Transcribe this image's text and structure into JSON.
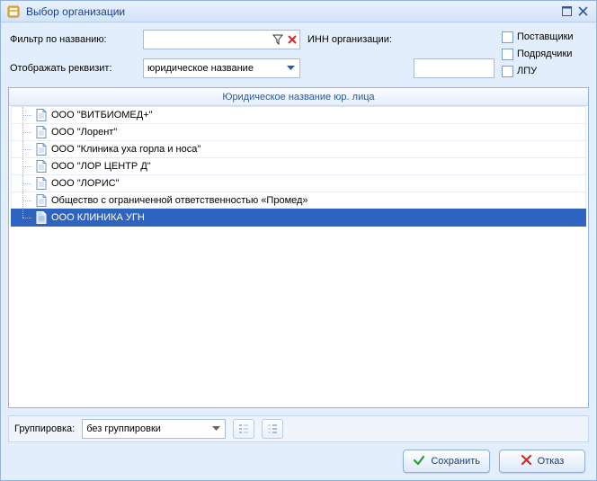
{
  "title": "Выбор организации",
  "labels": {
    "filterByName": "Фильтр по названию:",
    "showProp": "Отображать реквизит:",
    "inn": "ИНН организации:",
    "grouping": "Группировка:"
  },
  "checks": {
    "suppliers": "Поставщики",
    "contractors": "Подрядчики",
    "lpu": "ЛПУ"
  },
  "combo": {
    "showProp": "юридическое название",
    "grouping": "без группировки"
  },
  "gridHeader": "Юридическое название юр. лица",
  "rows": [
    "ООО \"ВИТБИОМЕД+\"",
    "ООО \"Лорент\"",
    "ООО \"Клиника уха горла и носа\"",
    "ООО \"ЛОР ЦЕНТР Д\"",
    "ООО \"ЛОРИС\"",
    "Общество с ограниченной ответственностью «Промед»",
    "ООО КЛИНИКА УГН"
  ],
  "selectedIndex": 6,
  "buttons": {
    "save": "Сохранить",
    "cancel": "Отказ"
  }
}
